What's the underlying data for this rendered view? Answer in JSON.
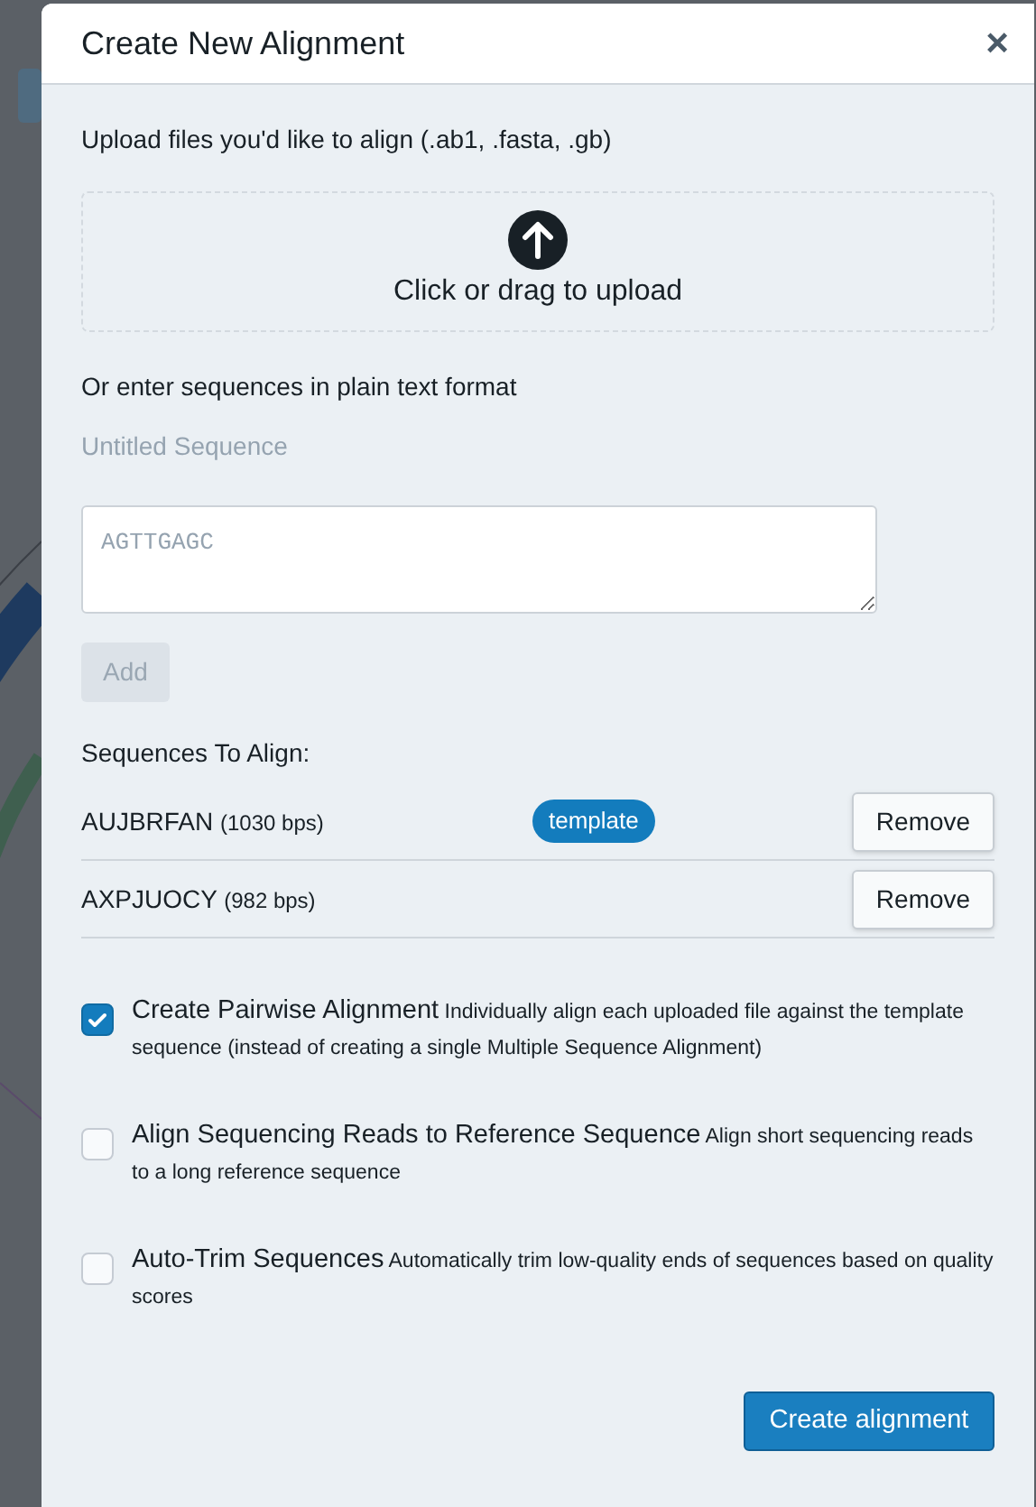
{
  "dialog": {
    "title": "Create New Alignment",
    "close": "×"
  },
  "upload": {
    "label": "Upload files you'd like to align (.ab1, .fasta, .gb)",
    "dropzone": "Click or drag to upload"
  },
  "manual": {
    "label": "Or enter sequences in plain text format",
    "name_placeholder": "Untitled Sequence",
    "sequence_placeholder": "AGTTGAGC",
    "add_button": {
      "label": "Add",
      "disabled": true
    }
  },
  "sequences": {
    "heading": "Sequences To Align:",
    "items": [
      {
        "name": "AUJBRFAN",
        "length": "(1030 bps)",
        "badge": "template",
        "action": "Remove"
      },
      {
        "name": "AXPJUOCY",
        "length": "(982 bps)",
        "action": "Remove"
      }
    ]
  },
  "options": [
    {
      "title": "Create Pairwise Alignment",
      "description": "Individually align each uploaded file against the template sequence (instead of creating a single Multiple Sequence Alignment)",
      "checked": true
    },
    {
      "title": "Align Sequencing Reads to Reference Sequence",
      "description": "Align short sequencing reads to a long reference sequence",
      "checked": false
    },
    {
      "title": "Auto-Trim Sequences",
      "description": "Automatically trim low-quality ends of sequences based on quality scores",
      "checked": false
    }
  ],
  "submit": "Create alignment"
}
